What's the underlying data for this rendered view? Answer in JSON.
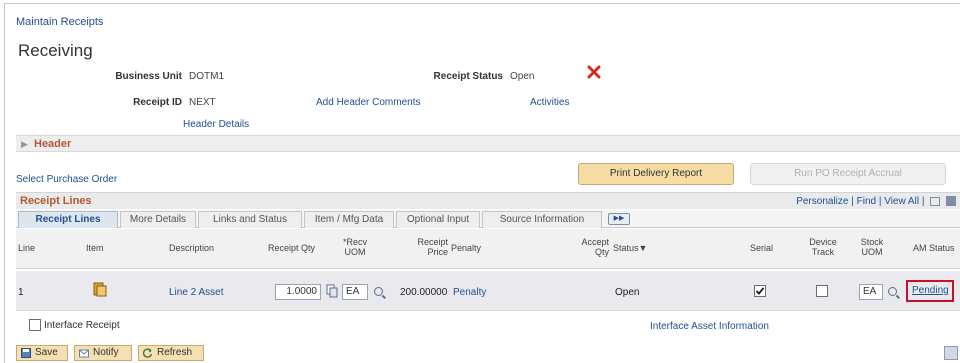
{
  "breadcrumb": "Maintain Receipts",
  "page_title": "Receiving",
  "header_fields": {
    "business_unit_label": "Business Unit",
    "business_unit_value": "DOTM1",
    "receipt_id_label": "Receipt ID",
    "receipt_id_value": "NEXT",
    "receipt_status_label": "Receipt Status",
    "receipt_status_value": "Open",
    "add_header_comments": "Add Header Comments",
    "activities": "Activities",
    "header_details": "Header Details"
  },
  "header_section": "Header",
  "select_purchase_order": "Select Purchase Order",
  "buttons": {
    "print_delivery_report": "Print Delivery Report",
    "run_po_receipt_accrual": "Run PO Receipt Accrual"
  },
  "grid": {
    "title": "Receipt Lines",
    "nav": "Personalize | Find | View All |",
    "tabs": [
      "Receipt Lines",
      "More Details",
      "Links and Status",
      "Item / Mfg Data",
      "Optional Input",
      "Source Information"
    ],
    "columns": {
      "line": "Line",
      "item": "Item",
      "description": "Description",
      "receipt_qty": "Receipt Qty",
      "recv_uom": "*Recv UOM",
      "receipt_price": "Receipt Price",
      "penalty": "Penalty",
      "accept_qty": "Accept Qty",
      "status": "Status",
      "serial": "Serial",
      "device_track": "Device Track",
      "stock_uom": "Stock UOM",
      "am_status": "AM Status"
    },
    "rows": [
      {
        "line": "1",
        "description": "Line 2 Asset",
        "receipt_qty": "1.0000",
        "recv_uom": "EA",
        "receipt_price": "200.00000",
        "penalty": "Penalty",
        "status": "Open",
        "serial_checked": true,
        "device_track_checked": false,
        "stock_uom": "EA",
        "am_status": "Pending"
      }
    ]
  },
  "interface_receipt": "Interface Receipt",
  "interface_asset_information": "Interface Asset Information",
  "toolbar": {
    "save": "Save",
    "notify": "Notify",
    "refresh": "Refresh"
  },
  "colors": {
    "link": "#21518f",
    "section_header": "#b4572f",
    "delete_x": "#d52b1e",
    "highlight_border": "#c8102e"
  }
}
